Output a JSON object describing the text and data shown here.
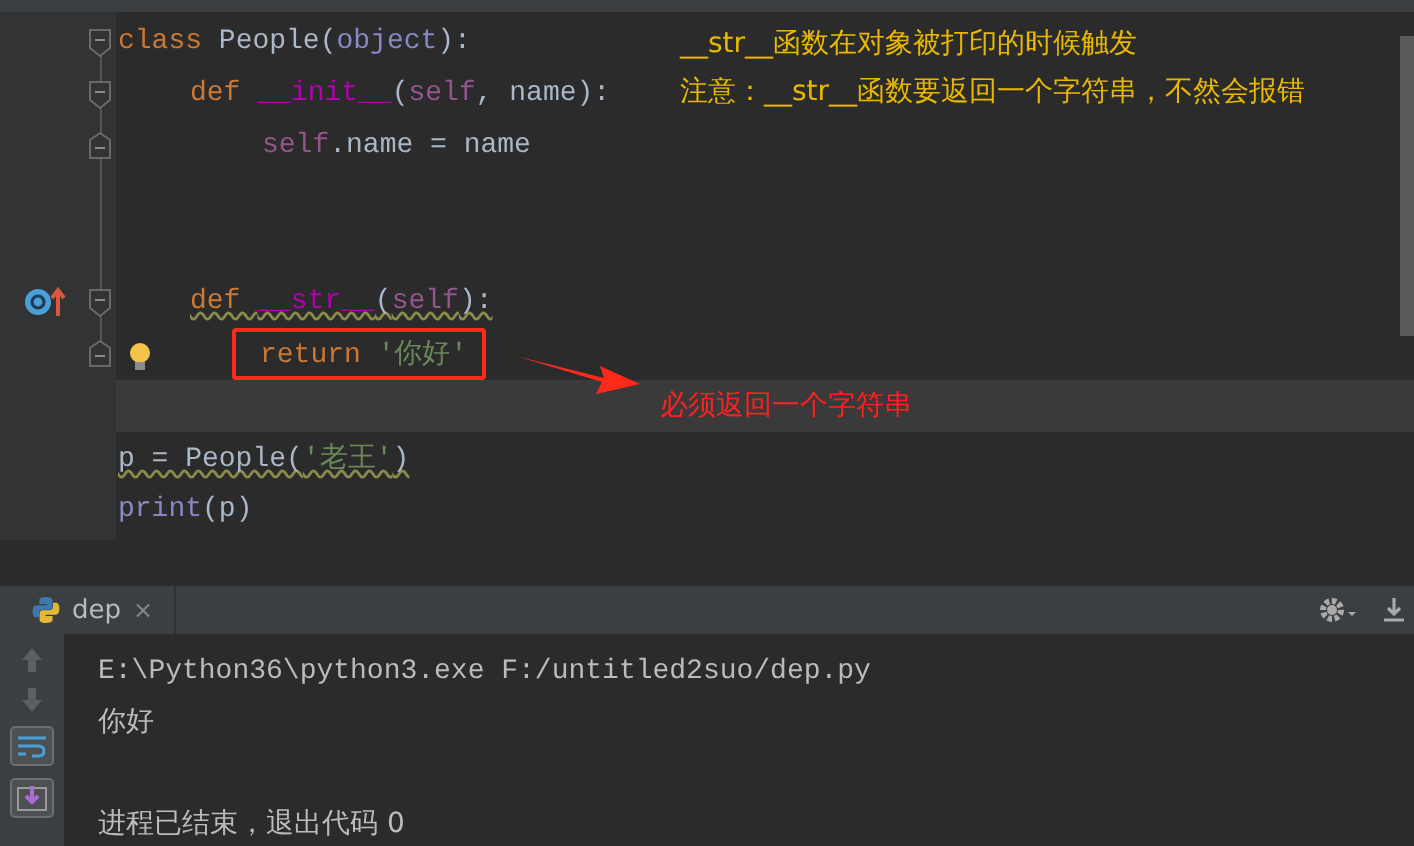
{
  "editor": {
    "lines": [
      {
        "kind": "code",
        "tokens": [
          {
            "text": "class ",
            "kind": "keyword"
          },
          {
            "text": "People(",
            "kind": "plain"
          },
          {
            "text": "object",
            "kind": "builtin"
          },
          {
            "text": "):",
            "kind": "plain"
          }
        ],
        "fold_start": true,
        "fold_end": false,
        "warning": false,
        "current": false,
        "override_marker": false,
        "bulb": false,
        "framed": false,
        "children": [
          {
            "kind": "code",
            "tokens": [
              {
                "text": "def ",
                "kind": "keyword"
              },
              {
                "text": "__init__",
                "kind": "magic"
              },
              {
                "text": "(",
                "kind": "plain"
              },
              {
                "text": "self",
                "kind": "self"
              },
              {
                "text": ", name):",
                "kind": "plain"
              }
            ],
            "fold_start": true,
            "fold_end": false,
            "warning": false,
            "current": false,
            "override_marker": false,
            "bulb": false,
            "framed": false,
            "children": [
              {
                "kind": "code",
                "tokens": [
                  {
                    "text": "self",
                    "kind": "self"
                  },
                  {
                    "text": ".name = name",
                    "kind": "plain"
                  }
                ],
                "fold_start": false,
                "fold_end": true,
                "warning": false,
                "current": false,
                "override_marker": false,
                "bulb": false,
                "framed": false
              }
            ]
          },
          {
            "kind": "blank",
            "current": false
          },
          {
            "kind": "blank",
            "current": false
          },
          {
            "kind": "code",
            "tokens": [
              {
                "text": "def ",
                "kind": "keyword"
              },
              {
                "text": "__str__",
                "kind": "magic"
              },
              {
                "text": "(",
                "kind": "plain"
              },
              {
                "text": "self",
                "kind": "self"
              },
              {
                "text": "):",
                "kind": "plain"
              }
            ],
            "fold_start": true,
            "fold_end": false,
            "warning": true,
            "current": false,
            "override_marker": true,
            "bulb": false,
            "framed": false,
            "children": [
              {
                "kind": "code",
                "tokens": [
                  {
                    "text": "return ",
                    "kind": "keyword"
                  },
                  {
                    "text": "'你好'",
                    "kind": "string"
                  }
                ],
                "fold_start": false,
                "fold_end": true,
                "warning": false,
                "current": false,
                "override_marker": false,
                "bulb": true,
                "framed": true
              }
            ]
          }
        ]
      },
      {
        "kind": "blank",
        "current": true
      },
      {
        "kind": "code",
        "tokens": [
          {
            "text": "p = People(",
            "kind": "plain"
          },
          {
            "text": "'老王'",
            "kind": "string"
          },
          {
            "text": ")",
            "kind": "plain"
          }
        ],
        "fold_start": false,
        "fold_end": false,
        "warning": true,
        "current": false,
        "override_marker": false,
        "bulb": false,
        "framed": false
      },
      {
        "kind": "code",
        "tokens": [
          {
            "text": "print",
            "kind": "builtin"
          },
          {
            "text": "(p)",
            "kind": "plain"
          }
        ],
        "fold_start": false,
        "fold_end": false,
        "warning": false,
        "current": false,
        "override_marker": false,
        "bulb": false,
        "framed": false
      }
    ],
    "notes": [
      "__str__函数在对象被打印的时候触发",
      "注意：__str__函数要返回一个字符串，不然会报错"
    ],
    "callout": "必须返回一个字符串"
  },
  "run_panel": {
    "tab": {
      "label": "dep",
      "close": "×"
    },
    "output": [
      {
        "text": "E:\\Python36\\python3.exe F:/untitled2suo/dep.py",
        "kind": "command"
      },
      {
        "text": "你好",
        "kind": "output"
      },
      {
        "text": "进程已结束，退出代码 0",
        "kind": "exit"
      }
    ]
  }
}
